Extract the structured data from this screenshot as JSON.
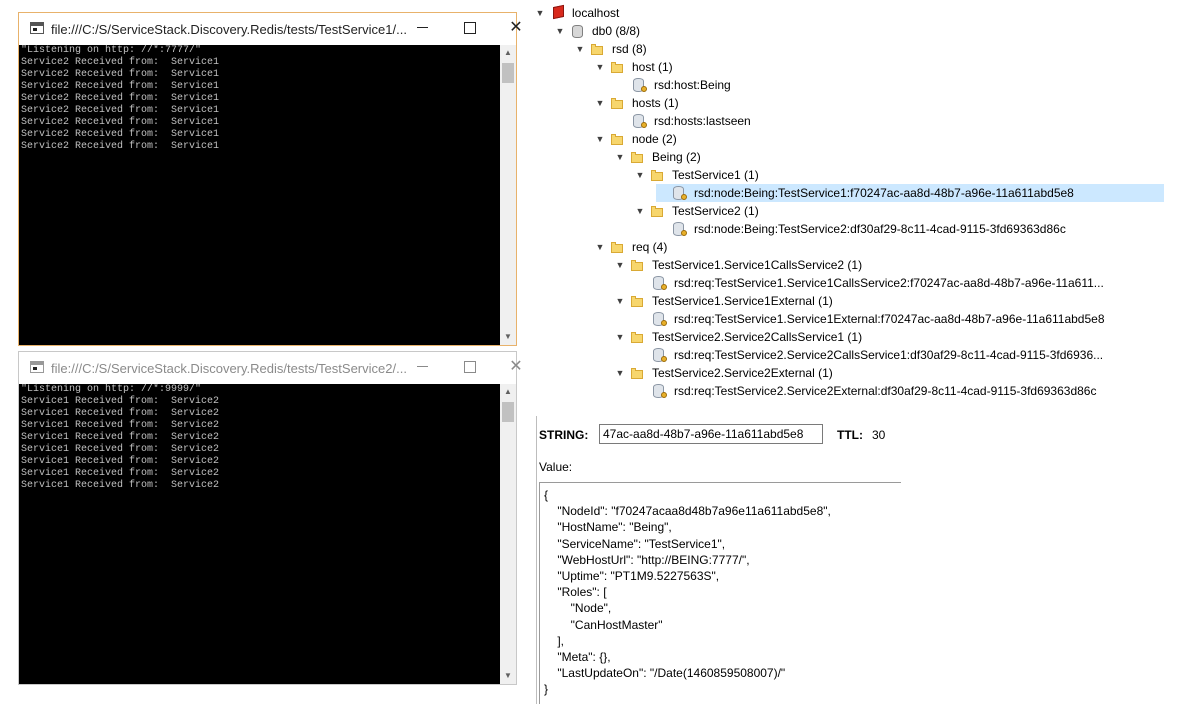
{
  "window1": {
    "title": "file:///C:/S/ServiceStack.Discovery.Redis/tests/TestService1/...",
    "lines": [
      "\"Listening on http: //*:7777/\"",
      "Service2 Received from:  Service1",
      "Service2 Received from:  Service1",
      "Service2 Received from:  Service1",
      "Service2 Received from:  Service1",
      "Service2 Received from:  Service1",
      "Service2 Received from:  Service1",
      "Service2 Received from:  Service1",
      "Service2 Received from:  Service1"
    ]
  },
  "window2": {
    "title": "file:///C:/S/ServiceStack.Discovery.Redis/tests/TestService2/...",
    "lines": [
      "\"Listening on http: //*:9999/\"",
      "Service1 Received from:  Service2",
      "Service1 Received from:  Service2",
      "Service1 Received from:  Service2",
      "Service1 Received from:  Service2",
      "Service1 Received from:  Service2",
      "Service1 Received from:  Service2",
      "Service1 Received from:  Service2",
      "Service1 Received from:  Service2"
    ]
  },
  "tree": [
    {
      "label": "localhost",
      "depth": 0,
      "icon": "server-icon",
      "expanded": true
    },
    {
      "label": "db0 (8/8)",
      "depth": 1,
      "icon": "database-icon",
      "expanded": true
    },
    {
      "label": "rsd (8)",
      "depth": 2,
      "icon": "folder-icon",
      "expanded": true
    },
    {
      "label": "host (1)",
      "depth": 3,
      "icon": "folder-icon",
      "expanded": true
    },
    {
      "label": "rsd:host:Being",
      "depth": 4,
      "icon": "key-icon"
    },
    {
      "label": "hosts (1)",
      "depth": 3,
      "icon": "folder-icon",
      "expanded": true
    },
    {
      "label": "rsd:hosts:lastseen",
      "depth": 4,
      "icon": "key-icon"
    },
    {
      "label": "node (2)",
      "depth": 3,
      "icon": "folder-icon",
      "expanded": true
    },
    {
      "label": "Being (2)",
      "depth": 4,
      "icon": "folder-icon",
      "expanded": true
    },
    {
      "label": "TestService1 (1)",
      "depth": 5,
      "icon": "folder-icon",
      "expanded": true
    },
    {
      "label": "rsd:node:Being:TestService1:f70247ac-aa8d-48b7-a96e-11a611abd5e8",
      "depth": 6,
      "icon": "key-icon",
      "selected": true
    },
    {
      "label": "TestService2 (1)",
      "depth": 5,
      "icon": "folder-icon",
      "expanded": true
    },
    {
      "label": "rsd:node:Being:TestService2:df30af29-8c11-4cad-9115-3fd69363d86c",
      "depth": 6,
      "icon": "key-icon"
    },
    {
      "label": "req (4)",
      "depth": 3,
      "icon": "folder-icon",
      "expanded": true
    },
    {
      "label": "TestService1.Service1CallsService2 (1)",
      "depth": 4,
      "icon": "folder-icon",
      "expanded": true
    },
    {
      "label": "rsd:req:TestService1.Service1CallsService2:f70247ac-aa8d-48b7-a96e-11a611...",
      "depth": 5,
      "icon": "key-icon"
    },
    {
      "label": "TestService1.Service1External (1)",
      "depth": 4,
      "icon": "folder-icon",
      "expanded": true
    },
    {
      "label": "rsd:req:TestService1.Service1External:f70247ac-aa8d-48b7-a96e-11a611abd5e8",
      "depth": 5,
      "icon": "key-icon"
    },
    {
      "label": "TestService2.Service2CallsService1 (1)",
      "depth": 4,
      "icon": "folder-icon",
      "expanded": true
    },
    {
      "label": "rsd:req:TestService2.Service2CallsService1:df30af29-8c11-4cad-9115-3fd6936...",
      "depth": 5,
      "icon": "key-icon"
    },
    {
      "label": "TestService2.Service2External (1)",
      "depth": 4,
      "icon": "folder-icon",
      "expanded": true
    },
    {
      "label": "rsd:req:TestService2.Service2External:df30af29-8c11-4cad-9115-3fd69363d86c",
      "depth": 5,
      "icon": "key-icon"
    }
  ],
  "value_panel": {
    "type_label": "STRING:",
    "key_value": "47ac-aa8d-48b7-a96e-11a611abd5e8",
    "ttl_label": "TTL:",
    "ttl_value": "30",
    "value_label": "Value:",
    "value_text": "{\n    \"NodeId\": \"f70247acaa8d48b7a96e11a611abd5e8\",\n    \"HostName\": \"Being\",\n    \"ServiceName\": \"TestService1\",\n    \"WebHostUrl\": \"http://BEING:7777/\",\n    \"Uptime\": \"PT1M9.5227563S\",\n    \"Roles\": [\n        \"Node\",\n        \"CanHostMaster\"\n    ],\n    \"Meta\": {},\n    \"LastUpdateOn\": \"/Date(1460859508007)/\"\n}"
  },
  "colors": {
    "selection": "#cce8ff",
    "active_window_border": "#e8b26b",
    "console_bg": "#000000",
    "console_text": "#c0c0c0"
  }
}
